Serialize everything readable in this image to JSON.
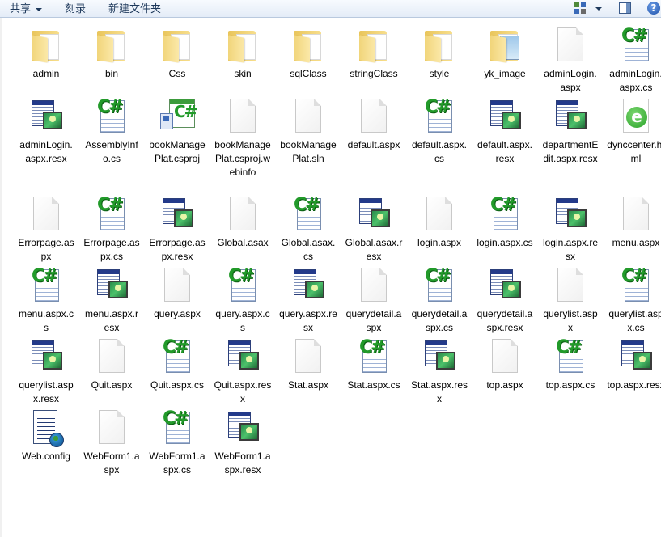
{
  "toolbar": {
    "share_label": "共享",
    "burn_label": "刻录",
    "new_folder_label": "新建文件夹"
  },
  "files": [
    {
      "name": "admin",
      "type": "folder"
    },
    {
      "name": "bin",
      "type": "folder"
    },
    {
      "name": "Css",
      "type": "folder"
    },
    {
      "name": "skin",
      "type": "folder"
    },
    {
      "name": "sqlClass",
      "type": "folder"
    },
    {
      "name": "stringClass",
      "type": "folder"
    },
    {
      "name": "style",
      "type": "folder"
    },
    {
      "name": "yk_image",
      "type": "image-folder"
    },
    {
      "name": "adminLogin.aspx",
      "type": "file"
    },
    {
      "name": "adminLogin.aspx.cs",
      "type": "cs"
    },
    {
      "name": "adminLogin.aspx.resx",
      "type": "resx"
    },
    {
      "name": "AssemblyInfo.cs",
      "type": "cs"
    },
    {
      "name": "bookManagePlat.csproj",
      "type": "csproj"
    },
    {
      "name": "bookManagePlat.csproj.webinfo",
      "type": "file"
    },
    {
      "name": "bookManagePlat.sln",
      "type": "file"
    },
    {
      "name": "default.aspx",
      "type": "file"
    },
    {
      "name": "default.aspx.cs",
      "type": "cs"
    },
    {
      "name": "default.aspx.resx",
      "type": "resx"
    },
    {
      "name": "departmentEdit.aspx.resx",
      "type": "resx"
    },
    {
      "name": "dynccenter.html",
      "type": "html"
    },
    {
      "name": "Errorpage.aspx",
      "type": "file"
    },
    {
      "name": "Errorpage.aspx.cs",
      "type": "cs"
    },
    {
      "name": "Errorpage.aspx.resx",
      "type": "resx"
    },
    {
      "name": "Global.asax",
      "type": "file"
    },
    {
      "name": "Global.asax.cs",
      "type": "cs"
    },
    {
      "name": "Global.asax.resx",
      "type": "resx"
    },
    {
      "name": "login.aspx",
      "type": "file"
    },
    {
      "name": "login.aspx.cs",
      "type": "cs"
    },
    {
      "name": "login.aspx.resx",
      "type": "resx"
    },
    {
      "name": "menu.aspx",
      "type": "file"
    },
    {
      "name": "menu.aspx.cs",
      "type": "cs"
    },
    {
      "name": "menu.aspx.resx",
      "type": "resx"
    },
    {
      "name": "query.aspx",
      "type": "file"
    },
    {
      "name": "query.aspx.cs",
      "type": "cs"
    },
    {
      "name": "query.aspx.resx",
      "type": "resx"
    },
    {
      "name": "querydetail.aspx",
      "type": "file"
    },
    {
      "name": "querydetail.aspx.cs",
      "type": "cs"
    },
    {
      "name": "querydetail.aspx.resx",
      "type": "resx"
    },
    {
      "name": "querylist.aspx",
      "type": "file"
    },
    {
      "name": "querylist.aspx.cs",
      "type": "cs"
    },
    {
      "name": "querylist.aspx.resx",
      "type": "resx"
    },
    {
      "name": "Quit.aspx",
      "type": "file"
    },
    {
      "name": "Quit.aspx.cs",
      "type": "cs"
    },
    {
      "name": "Quit.aspx.resx",
      "type": "resx"
    },
    {
      "name": "Stat.aspx",
      "type": "file"
    },
    {
      "name": "Stat.aspx.cs",
      "type": "cs"
    },
    {
      "name": "Stat.aspx.resx",
      "type": "resx"
    },
    {
      "name": "top.aspx",
      "type": "file"
    },
    {
      "name": "top.aspx.cs",
      "type": "cs"
    },
    {
      "name": "top.aspx.resx",
      "type": "resx"
    },
    {
      "name": "Web.config",
      "type": "config"
    },
    {
      "name": "WebForm1.aspx",
      "type": "file"
    },
    {
      "name": "WebForm1.aspx.cs",
      "type": "cs"
    },
    {
      "name": "WebForm1.aspx.resx",
      "type": "resx"
    }
  ]
}
